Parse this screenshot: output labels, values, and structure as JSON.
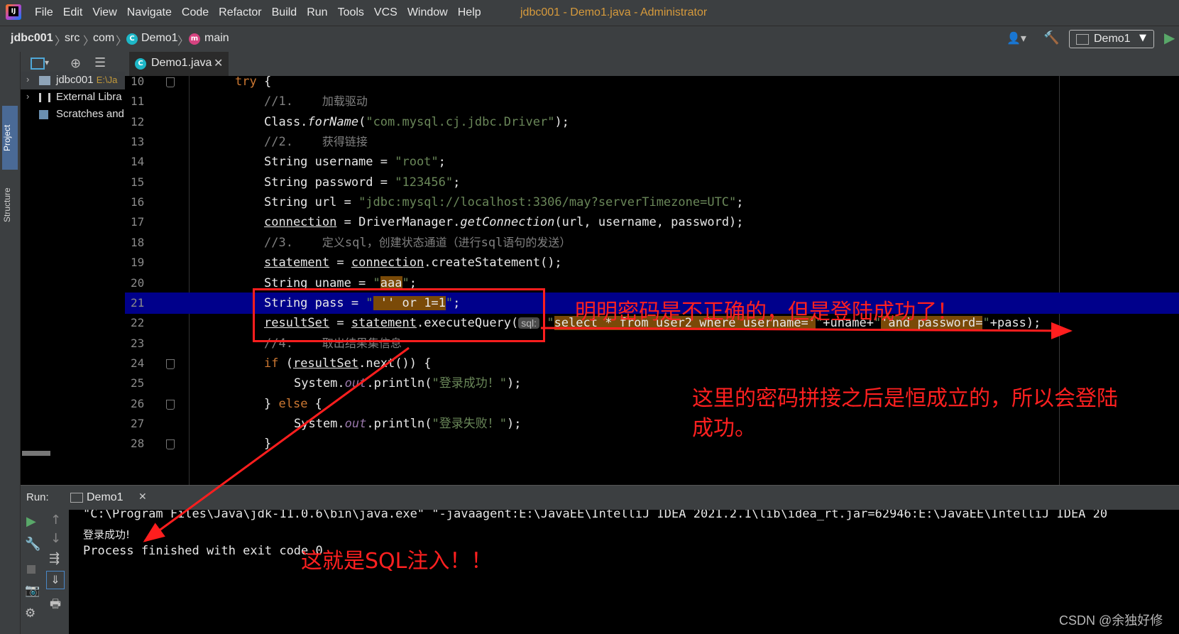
{
  "app": {
    "logo_text": "IJ",
    "menu": [
      "File",
      "Edit",
      "View",
      "Navigate",
      "Code",
      "Refactor",
      "Build",
      "Run",
      "Tools",
      "VCS",
      "Window",
      "Help"
    ],
    "window_title": "jdbc001 - Demo1.java - Administrator"
  },
  "breadcrumb": {
    "project": "jdbc001",
    "src": "src",
    "package": "com",
    "class": "Demo1",
    "method": "main",
    "run_config": "Demo1"
  },
  "sidebar": {
    "project_tab": "Project",
    "structure_tab": "Structure",
    "items": [
      {
        "label": "jdbc001",
        "suffix": "E:\\Ja"
      },
      {
        "label": "External Libra"
      },
      {
        "label": "Scratches and"
      }
    ]
  },
  "editor": {
    "tab_label": "Demo1.java",
    "current_line": 21,
    "lines": [
      {
        "n": "10",
        "code": "try {"
      },
      {
        "n": "11",
        "code": "//1.    加载驱动"
      },
      {
        "n": "12",
        "code": "Class.forName(\"com.mysql.cj.jdbc.Driver\");"
      },
      {
        "n": "13",
        "code": "//2.    获得链接"
      },
      {
        "n": "14",
        "code": "String username = \"root\";"
      },
      {
        "n": "15",
        "code": "String password = \"123456\";"
      },
      {
        "n": "16",
        "code": "String url = \"jdbc:mysql://localhost:3306/may?serverTimezone=UTC\";"
      },
      {
        "n": "17",
        "code": "connection = DriverManager.getConnection(url, username, password);"
      },
      {
        "n": "18",
        "code": "//3.    定义sql，创建状态通道（进行sql语句的发送）"
      },
      {
        "n": "19",
        "code": "statement = connection.createStatement();"
      },
      {
        "n": "20",
        "code": "String uname = \"aaa\";"
      },
      {
        "n": "21",
        "code": "String pass = \" '' or 1=1\";"
      },
      {
        "n": "22",
        "code": "resultSet = statement.executeQuery(\"select * from user2 where username='\"+uname+\"'and password=\"+pass);"
      },
      {
        "n": "23",
        "code": "//4.    取出结果集信息"
      },
      {
        "n": "24",
        "code": "if (resultSet.next()) {"
      },
      {
        "n": "25",
        "code": "System.out.println(\"登录成功！\");"
      },
      {
        "n": "26",
        "code": "} else {"
      },
      {
        "n": "27",
        "code": "System.out.println(\"登录失败！\");"
      },
      {
        "n": "28",
        "code": "}"
      }
    ],
    "sql_badge": "sql:"
  },
  "run": {
    "label": "Run:",
    "tab_label": "Demo1",
    "console": [
      "\"C:\\Program Files\\Java\\jdk-11.0.6\\bin\\java.exe\" \"-javaagent:E:\\JavaEE\\IntelliJ IDEA 2021.2.1\\lib\\idea_rt.jar=62946:E:\\JavaEE\\IntelliJ IDEA 20",
      "登录成功!",
      "",
      "Process finished with exit code 0"
    ]
  },
  "annotations": {
    "wrong_password": "明明密码是不正确的，但是登陆成功了！",
    "always_true": "这里的密码拼接之后是恒成立的，所以会登陆",
    "always_true_2": "成功。",
    "sql_injection": "这就是SQL注入！！",
    "color": "#ff2020"
  },
  "watermark": "CSDN @余独好修"
}
